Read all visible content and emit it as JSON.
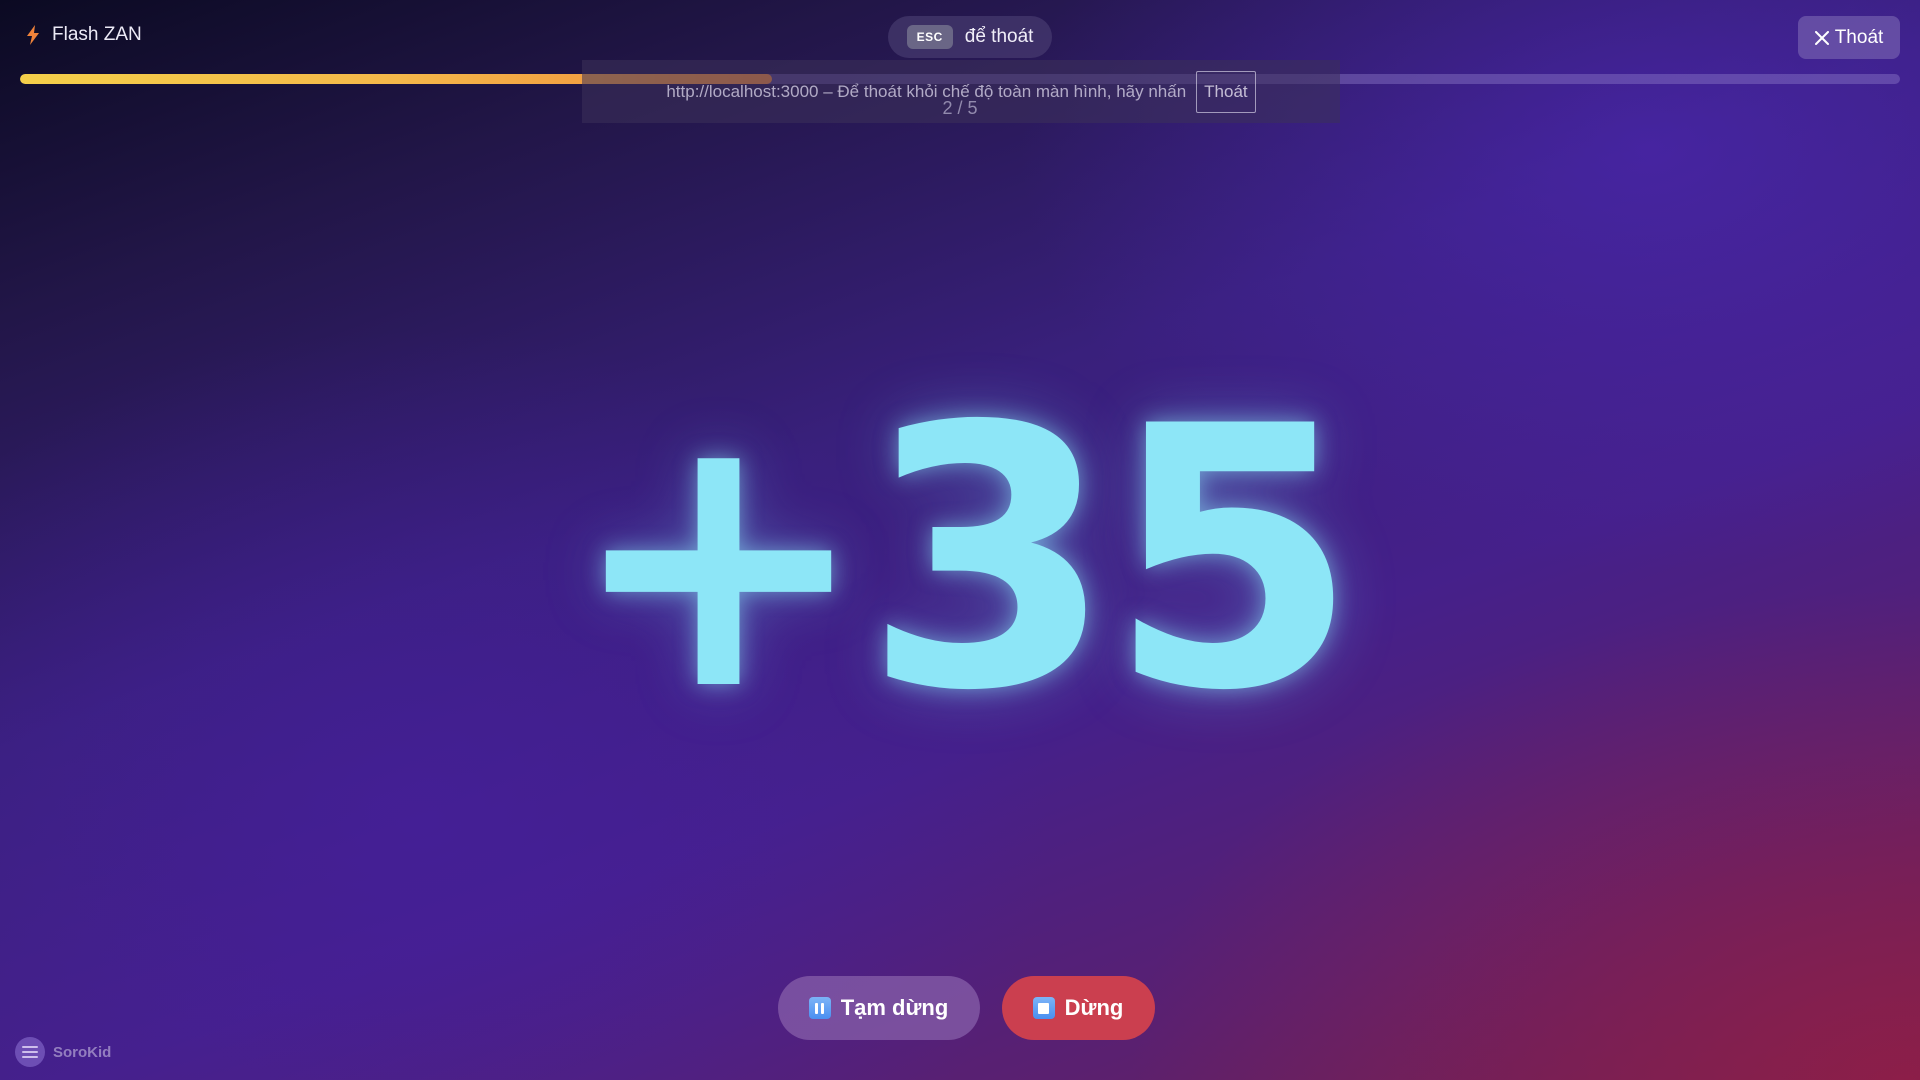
{
  "app": {
    "title": "Flash ZAN",
    "icon": "lightning-icon"
  },
  "esc_hint": {
    "key": "ESC",
    "text": "để thoát"
  },
  "exit_button": {
    "label": "Thoát",
    "icon": "close-icon"
  },
  "progress": {
    "fraction": 0.4
  },
  "fullscreen_notice": {
    "text": "http://localhost:3000 – Để thoát khỏi chế độ toàn màn hình, hãy nhấn",
    "button_label": "Thoát"
  },
  "step_counter": "2 / 5",
  "flash": {
    "value": "+35",
    "color": "#8de6f7"
  },
  "controls": {
    "pause_label": "Tạm dừng",
    "pause_icon": "pause-icon",
    "stop_label": "Dừng",
    "stop_icon": "stop-icon",
    "stop_color": "#cb3f4f"
  },
  "brand": {
    "name": "SoroKid",
    "icon": "abacus-icon"
  }
}
